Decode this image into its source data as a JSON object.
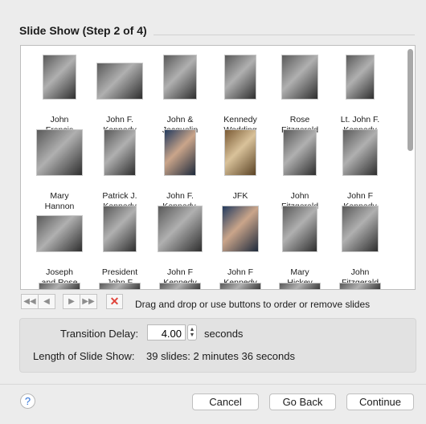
{
  "title": "Slide Show (Step 2 of 4)",
  "slides": [
    {
      "caption": "John\nFrancis",
      "tone": "bw"
    },
    {
      "caption": "John F.\nKennedy",
      "tone": "bw"
    },
    {
      "caption": "John &\nJacquelin",
      "tone": "bw"
    },
    {
      "caption": "Kennedy\nWedding",
      "tone": "bw"
    },
    {
      "caption": "Rose\nFitzgerald",
      "tone": "bw"
    },
    {
      "caption": "Lt. John F.\nKennedy",
      "tone": "bw"
    },
    {
      "caption": "Mary\nHannon",
      "tone": "bw"
    },
    {
      "caption": "Patrick J.\nKennedy",
      "tone": "bw"
    },
    {
      "caption": "John F.\nKennedy,",
      "tone": "color"
    },
    {
      "caption": "JFK",
      "tone": "sepia"
    },
    {
      "caption": "John\nFitzgerald",
      "tone": "bw"
    },
    {
      "caption": "John F\nKennedy",
      "tone": "bw"
    },
    {
      "caption": "Joseph\nand Rose",
      "tone": "bw"
    },
    {
      "caption": "President\nJohn F",
      "tone": "bw"
    },
    {
      "caption": "John F\nKennedy",
      "tone": "bw"
    },
    {
      "caption": "John F\nKennedy",
      "tone": "color"
    },
    {
      "caption": "Mary\nHickey",
      "tone": "bw"
    },
    {
      "caption": "John\nFitzgerald",
      "tone": "bw"
    }
  ],
  "toolbar": {
    "first_icon": "move-first-icon",
    "prev_icon": "move-left-icon",
    "next_icon": "move-right-icon",
    "last_icon": "move-last-icon",
    "remove_icon": "remove-x-icon"
  },
  "hint": "Drag and drop or use buttons to order or remove slides",
  "transition": {
    "label": "Transition Delay:",
    "value": "4.00",
    "unit": "seconds"
  },
  "length": {
    "label": "Length of Slide Show:",
    "value": "39 slides: 2 minutes 36 seconds"
  },
  "buttons": {
    "help": "?",
    "cancel": "Cancel",
    "back": "Go Back",
    "continue": "Continue"
  }
}
